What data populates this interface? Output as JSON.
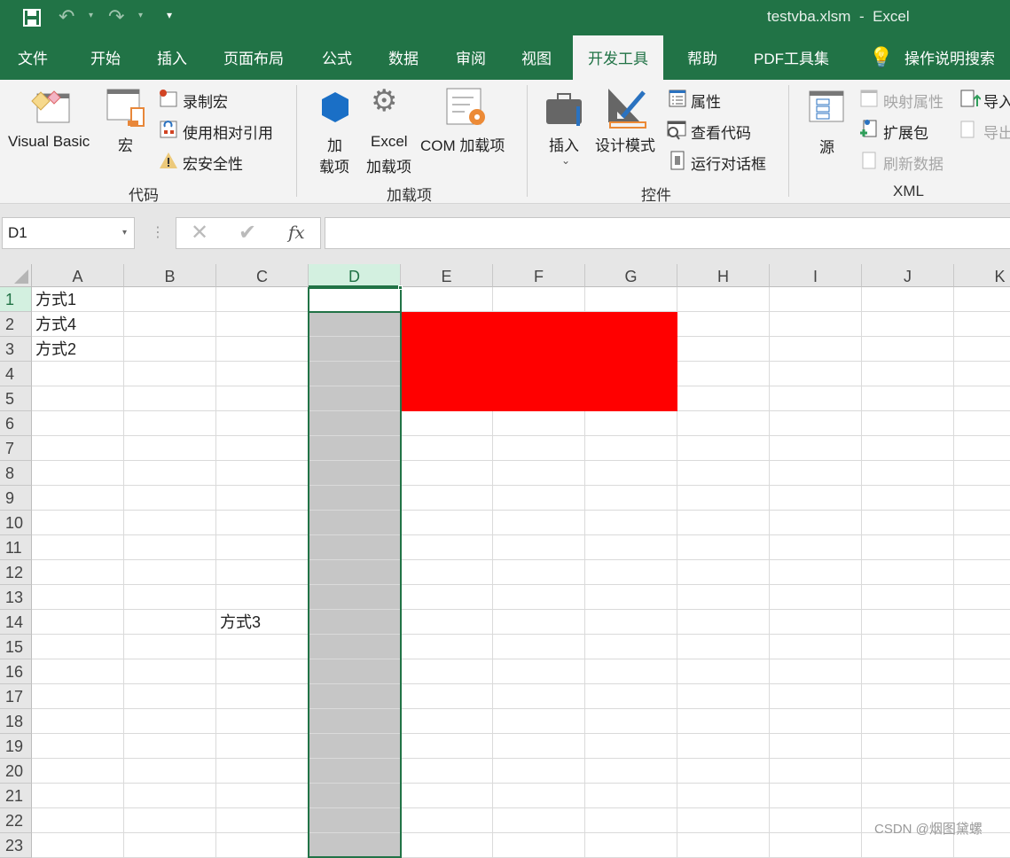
{
  "title": {
    "file": "testvba.xlsm",
    "sep": "-",
    "app": "Excel"
  },
  "tabs": [
    "文件",
    "开始",
    "插入",
    "页面布局",
    "公式",
    "数据",
    "审阅",
    "视图",
    "开发工具",
    "帮助",
    "PDF工具集"
  ],
  "active_tab": "开发工具",
  "tell_me": "操作说明搜索",
  "ribbon": {
    "code": {
      "label": "代码",
      "visual_basic": "Visual Basic",
      "macros": "宏",
      "record": "录制宏",
      "relative": "使用相对引用",
      "security": "宏安全性"
    },
    "addins": {
      "label": "加载项",
      "addins1": "加",
      "addins2": "载项",
      "excel1": "Excel",
      "excel2": "加载项",
      "com": "COM 加载项"
    },
    "controls": {
      "label": "控件",
      "insert": "插入",
      "design": "设计模式",
      "properties": "属性",
      "view_code": "查看代码",
      "run_dialog": "运行对话框"
    },
    "xml": {
      "label": "XML",
      "source": "源",
      "map_props": "映射属性",
      "expansion": "扩展包",
      "refresh": "刷新数据",
      "import": "导入",
      "export": "导出"
    }
  },
  "name_box": "D1",
  "formula": "",
  "columns": [
    "A",
    "B",
    "C",
    "D",
    "E",
    "F",
    "G",
    "H",
    "I",
    "J",
    "K"
  ],
  "rows": [
    "1",
    "2",
    "3",
    "4",
    "5",
    "6",
    "7",
    "8",
    "9",
    "10",
    "11",
    "12",
    "13",
    "14",
    "15",
    "16",
    "17",
    "18",
    "19",
    "20",
    "21",
    "22",
    "23"
  ],
  "cells": [
    {
      "ref": "A1",
      "value": "方式1"
    },
    {
      "ref": "A2",
      "value": "方式4"
    },
    {
      "ref": "A3",
      "value": "方式2"
    },
    {
      "ref": "C14",
      "value": "方式3"
    }
  ],
  "fills": {
    "red_range": "E2:G5",
    "red": "#ff0000",
    "gray_range": "D2:D23",
    "gray": "#c6c6c6"
  },
  "selected": "D1",
  "colors": {
    "brand": "#217346"
  },
  "watermark": "CSDN @烟图黛螺"
}
